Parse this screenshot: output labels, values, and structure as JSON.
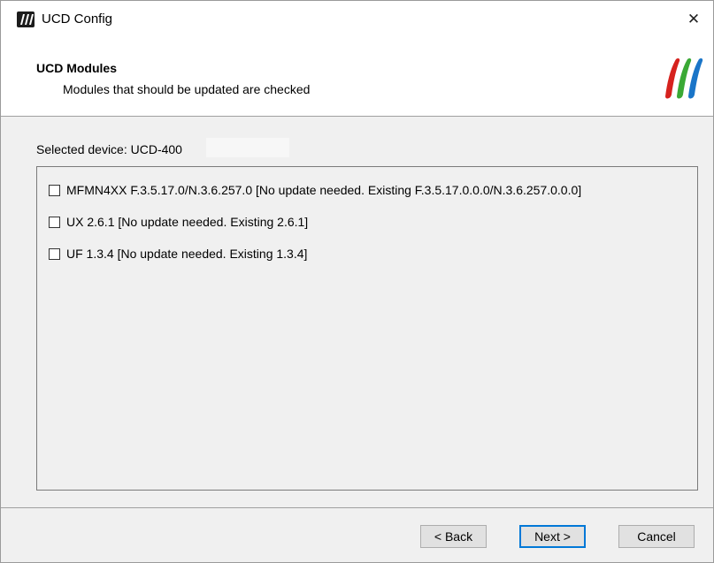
{
  "window": {
    "title": "UCD Config",
    "close_glyph": "✕",
    "app_icon": "ucd-logo-icon"
  },
  "header": {
    "title": "UCD Modules",
    "subtitle": "Modules that should be updated are checked",
    "logo": "ucd-logo-icon",
    "logo_colors": [
      "#d6221e",
      "#3aa935",
      "#1a75c8"
    ]
  },
  "device": {
    "label": "Selected device: UCD-400"
  },
  "modules": [
    {
      "label": "MFMN4XX F.3.5.17.0/N.3.6.257.0 [No update needed. Existing F.3.5.17.0.0.0/N.3.6.257.0.0.0]",
      "checked": false
    },
    {
      "label": "UX 2.6.1 [No update needed. Existing 2.6.1]",
      "checked": false
    },
    {
      "label": "UF 1.3.4 [No update needed. Existing 1.3.4]",
      "checked": false
    }
  ],
  "buttons": {
    "back": "< Back",
    "next": "Next >",
    "cancel": "Cancel"
  }
}
